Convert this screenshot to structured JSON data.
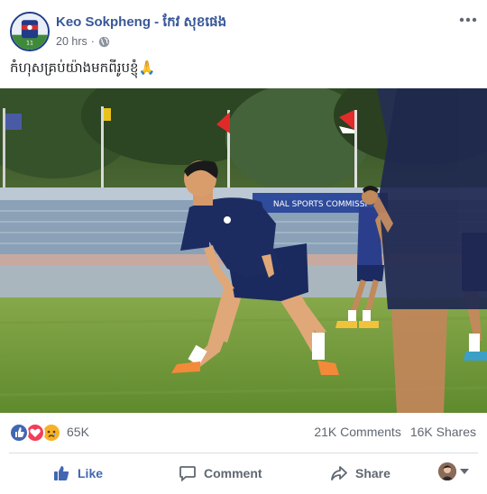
{
  "post": {
    "author": "Keo Sokpheng - កែវ សុខផេង",
    "time": "20 hrs",
    "separator": "·",
    "caption": "កំហុសគ្រប់យ៉ាងមកពីរូបខ្ញុំ🙏",
    "privacy_icon": "globe-icon",
    "avatar_icon": "profile-avatar"
  },
  "photo": {
    "banner_text": "NAL SPORTS COMMISSI"
  },
  "reactions": {
    "icons": [
      "like-icon",
      "love-icon",
      "sad-icon"
    ],
    "count": "65K",
    "comments": "21K Comments",
    "shares": "16K Shares"
  },
  "actions": {
    "like_label": "Like",
    "comment_label": "Comment",
    "share_label": "Share"
  },
  "colors": {
    "link_blue": "#385898",
    "like_blue": "#4267b2",
    "muted": "#606770",
    "love_red": "#f33e58",
    "sad_yellow": "#f7b125"
  }
}
